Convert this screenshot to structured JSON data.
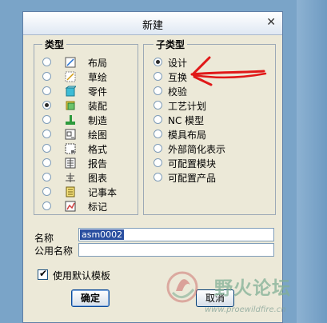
{
  "dialog": {
    "title": "新建",
    "close_glyph": "✕"
  },
  "type_group": {
    "legend": "类型",
    "items": [
      {
        "label": "布局",
        "icon": "layout-icon",
        "selected": false
      },
      {
        "label": "草绘",
        "icon": "sketch-icon",
        "selected": false
      },
      {
        "label": "零件",
        "icon": "part-icon",
        "selected": false
      },
      {
        "label": "装配",
        "icon": "assembly-icon",
        "selected": true
      },
      {
        "label": "制造",
        "icon": "manufacturing-icon",
        "selected": false
      },
      {
        "label": "绘图",
        "icon": "drawing-icon",
        "selected": false
      },
      {
        "label": "格式",
        "icon": "format-icon",
        "selected": false
      },
      {
        "label": "报告",
        "icon": "report-icon",
        "selected": false
      },
      {
        "label": "图表",
        "icon": "diagram-icon",
        "selected": false
      },
      {
        "label": "记事本",
        "icon": "notebook-icon",
        "selected": false
      },
      {
        "label": "标记",
        "icon": "markup-icon",
        "selected": false
      }
    ]
  },
  "subtype_group": {
    "legend": "子类型",
    "items": [
      {
        "label": "设计",
        "selected": true
      },
      {
        "label": "互换",
        "selected": false
      },
      {
        "label": "校验",
        "selected": false
      },
      {
        "label": "工艺计划",
        "selected": false
      },
      {
        "label": "NC 模型",
        "selected": false
      },
      {
        "label": "模具布局",
        "selected": false
      },
      {
        "label": "外部简化表示",
        "selected": false
      },
      {
        "label": "可配置模块",
        "selected": false
      },
      {
        "label": "可配置产品",
        "selected": false
      }
    ]
  },
  "name_field": {
    "label": "名称",
    "value": "asm0002"
  },
  "common_name_field": {
    "label": "公用名称",
    "value": ""
  },
  "default_template": {
    "label": "使用默认模板",
    "checked": true
  },
  "buttons": {
    "ok": "确定",
    "cancel": "取消"
  },
  "watermark": {
    "text": "野火论坛",
    "url": "www.proewildfire.cn"
  },
  "colors": {
    "annotation_red": "#e01818",
    "selection_blue": "#2a4fa0"
  }
}
